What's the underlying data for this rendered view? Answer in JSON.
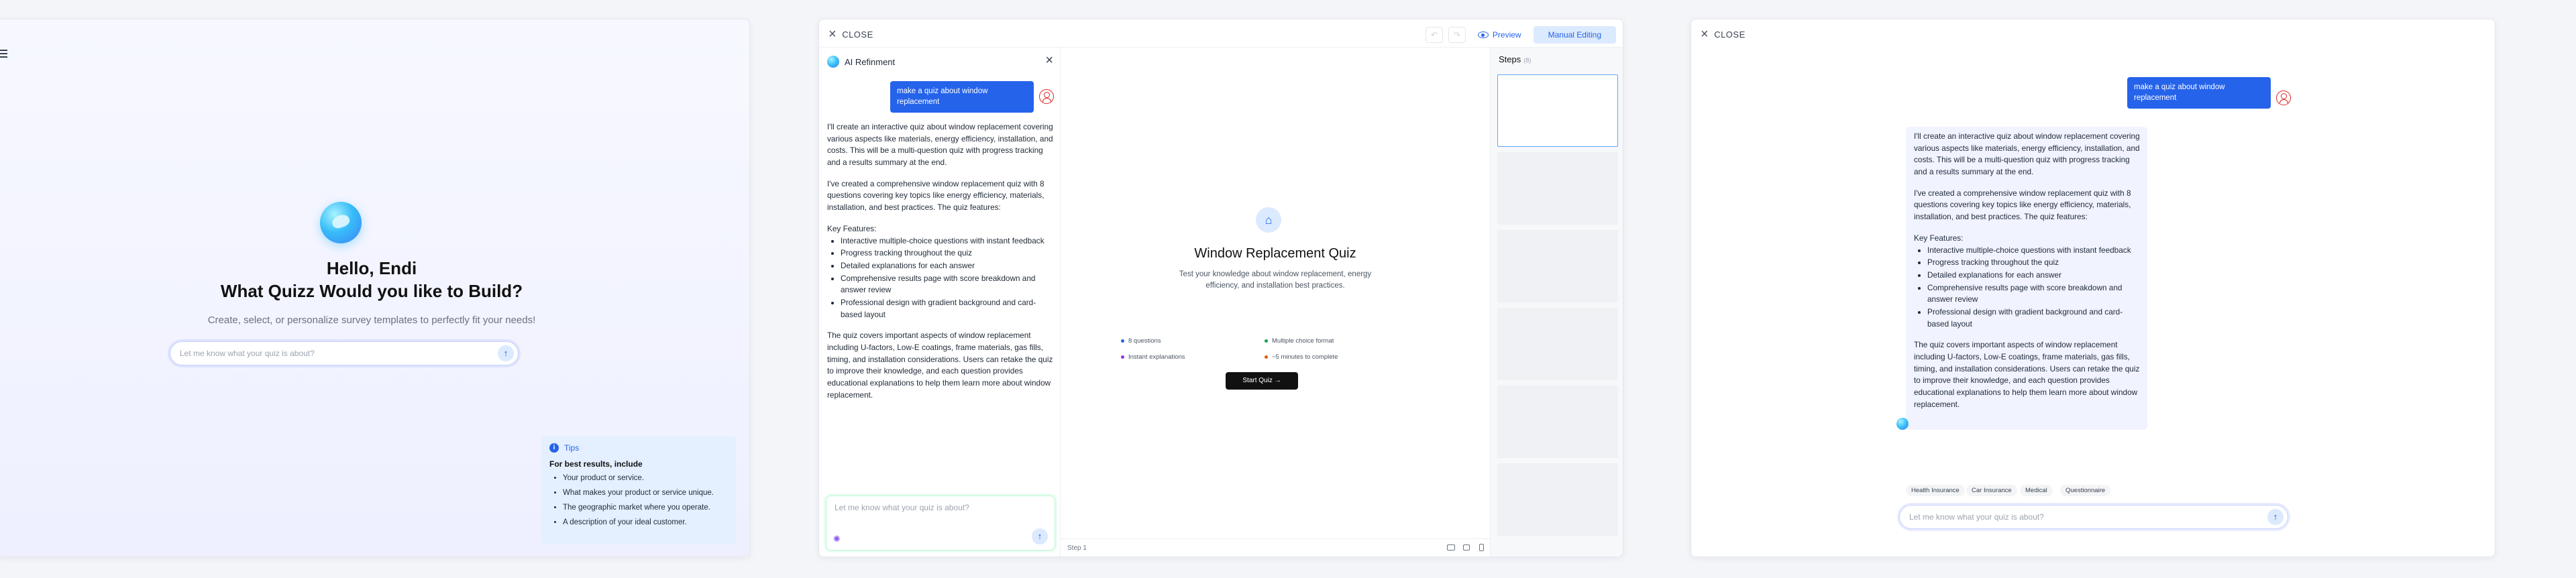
{
  "panel1": {
    "greeting": "Hello, Endi",
    "title": "What Quizz Would you like to Build?",
    "subtitle": "Create, select, or personalize survey templates to perfectly fit your needs!",
    "input_placeholder": "Let me know what your quiz is about?",
    "tips": {
      "label": "Tips",
      "title": "For best results, include",
      "items": [
        "Your product or service.",
        "What makes your product or service unique.",
        "The geographic market where you operate.",
        "A description of your ideal customer."
      ]
    }
  },
  "panel2": {
    "close_label": "CLOSE",
    "preview_label": "Preview",
    "manual_label": "Manual Editing",
    "undo_icon": "↶",
    "redo_icon": "↷",
    "ai_title": "AI Refinment",
    "user_message": "make a  quiz about window replacement",
    "response": {
      "p1": "I'll create an interactive quiz about window replacement covering various aspects like materials, energy efficiency, installation, and costs. This will be a multi-question quiz with progress tracking and a results summary at the end.",
      "p2": "I've created a comprehensive window replacement quiz with 8 questions covering key topics like energy efficiency, materials, installation, and best practices. The quiz features:",
      "features_label": "Key Features:",
      "features": [
        "Interactive multiple-choice questions with instant feedback",
        "Progress tracking throughout the quiz",
        "Detailed explanations for each answer",
        "Comprehensive results page with score breakdown and answer review",
        "Professional design with gradient background and card-based layout"
      ],
      "p3": "The quiz covers important aspects of window replacement including U-factors, Low-E coatings, frame materials, gas fills, timing, and installation considerations. Users can retake the quiz to improve their knowledge, and each question provides educational explanations to help them learn more about window replacement."
    },
    "input_placeholder": "Let me know what your quiz is about?",
    "quiz": {
      "title": "Window Replacement Quiz",
      "description": "Test your knowledge about window replacement, energy efficiency, and installation best practices.",
      "features": [
        {
          "text": "8 questions",
          "color": "#2563eb"
        },
        {
          "text": "Multiple choice format",
          "color": "#16a34a"
        },
        {
          "text": "Instant explanations",
          "color": "#9333ea"
        },
        {
          "text": "~5 minutes to complete",
          "color": "#ea580c"
        }
      ],
      "start_label": "Start Quiz  →"
    },
    "step_label": "Step 1",
    "steps_title": "Steps",
    "steps_count": "(8)"
  },
  "panel3": {
    "close_label": "CLOSE",
    "user_message": "make a quiz about window replacement",
    "chips": [
      "Health Insurance",
      "Car Insurance",
      "Medical",
      "Questionnaire"
    ],
    "input_placeholder": "Let me know what your quiz is about?"
  }
}
